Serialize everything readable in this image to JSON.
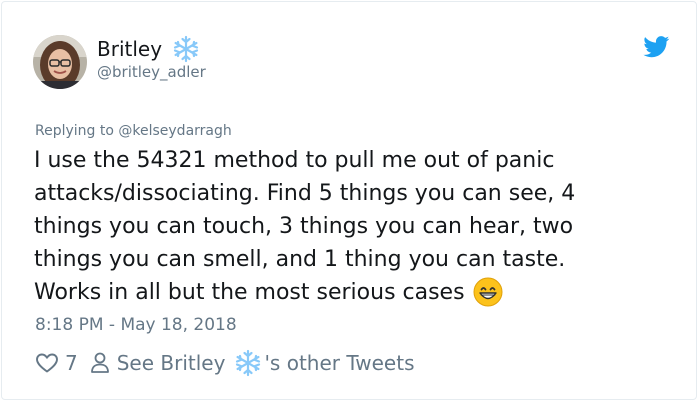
{
  "tweet": {
    "author": {
      "display_name": "Britley",
      "name_emoji": "snowflake-icon",
      "handle": "@britley_adler"
    },
    "replying_to": "Replying to @kelseydarragh",
    "text_lines": [
      "I use the 54321 method to pull me out of panic",
      "attacks/dissociating. Find 5 things you can see, 4",
      "things you can touch, 3 things you can hear, two",
      "things you can smell, and 1 thing you can taste.",
      "Works in all but the most serious cases"
    ],
    "trailing_emoji": "grinning-face-icon",
    "timestamp": "8:18 PM - May 18, 2018",
    "likes": "7",
    "see_link": {
      "prefix": "See Britley",
      "suffix": "'s other Tweets"
    }
  },
  "colors": {
    "text": "#14171a",
    "muted": "#657786",
    "twitter_blue": "#1da1f2",
    "snowflake": "#88c9f9",
    "border": "#e6ecf0"
  }
}
